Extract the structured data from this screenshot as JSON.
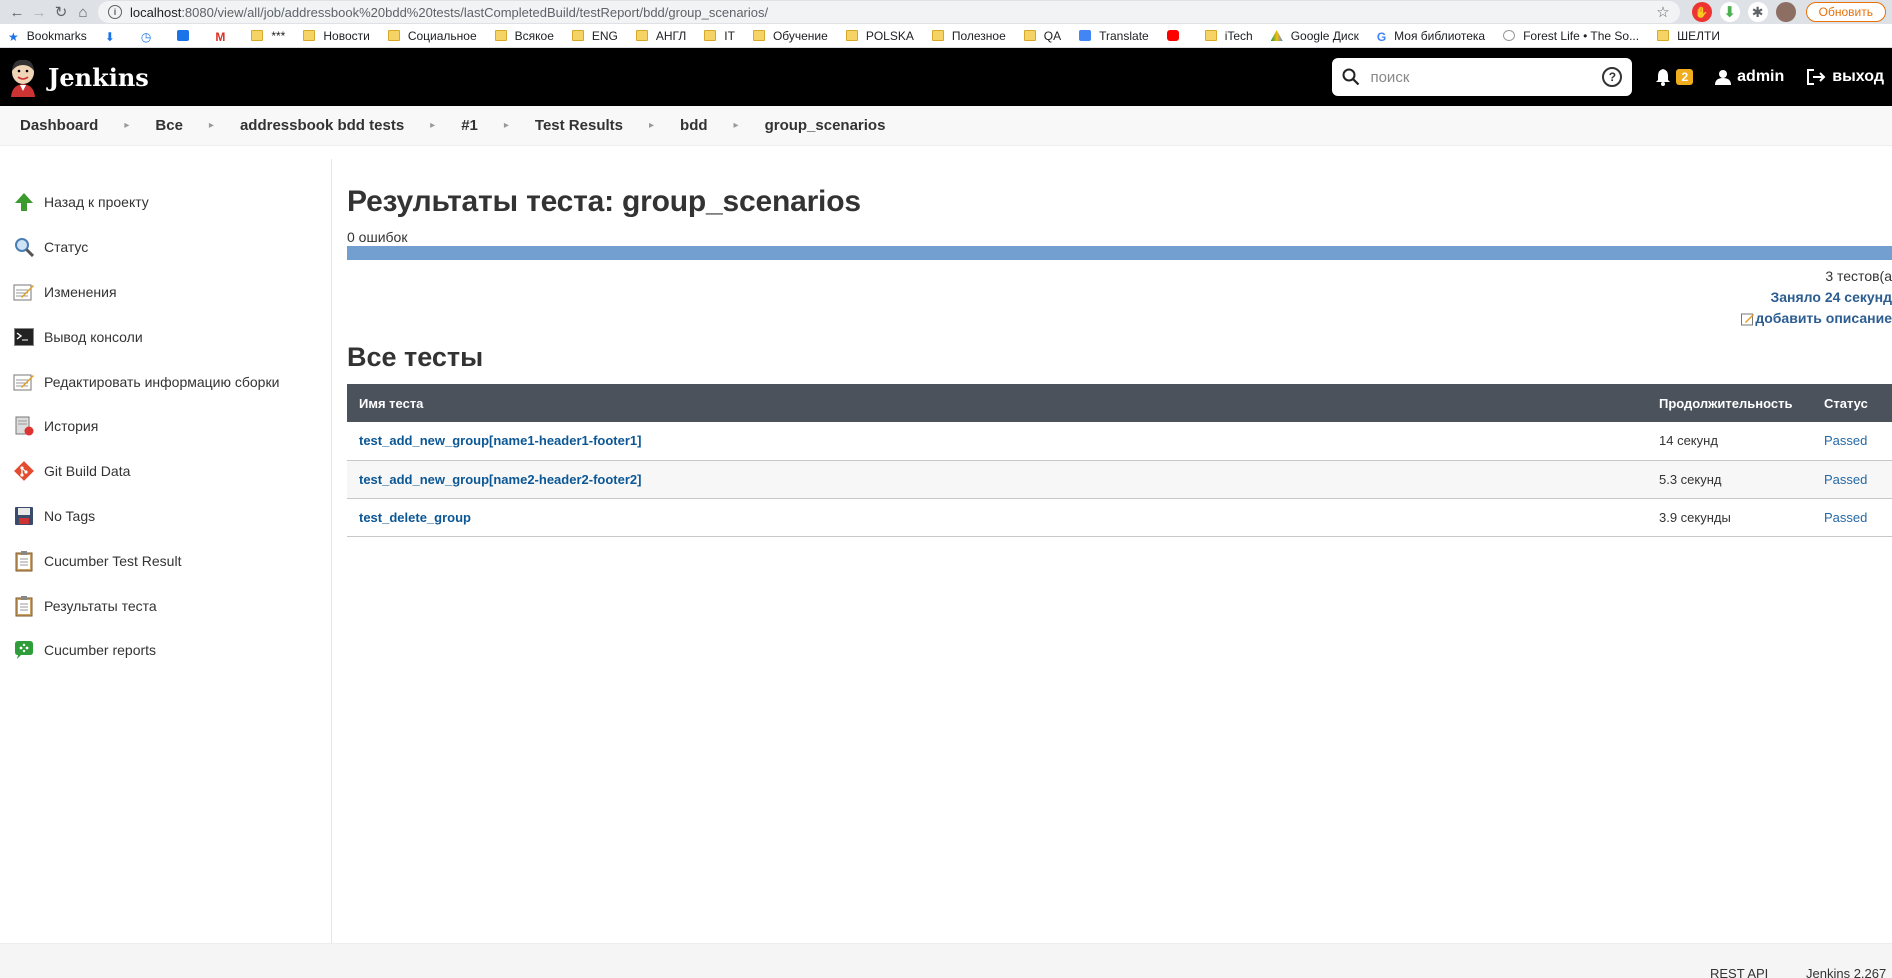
{
  "browser": {
    "address_host": "localhost",
    "address_path": ":8080/view/all/job/addressbook%20bdd%20tests/lastCompletedBuild/testReport/bdd/group_scenarios/",
    "update_label": "Обновить",
    "bookmarks": [
      "Bookmarks",
      "***",
      "Новости",
      "Социальное",
      "Всякое",
      "ENG",
      "АНГЛ",
      "IT",
      "Обучение",
      "POLSKA",
      "Полезное",
      "QA",
      "Translate",
      "iTech",
      "Google Диск",
      "Моя библиотека",
      "Forest Life • The So...",
      "ШЕЛТИ"
    ]
  },
  "header": {
    "logo_text": "Jenkins",
    "search_placeholder": "поиск",
    "notifications_count": "2",
    "user": "admin",
    "logout": "выход"
  },
  "breadcrumbs": [
    "Dashboard",
    "Все",
    "addressbook bdd tests",
    "#1",
    "Test Results",
    "bdd",
    "group_scenarios"
  ],
  "sidebar": {
    "items": [
      {
        "label": "Назад к проекту",
        "icon": "up-arrow-icon"
      },
      {
        "label": "Статус",
        "icon": "magnifier-icon"
      },
      {
        "label": "Изменения",
        "icon": "notepad-icon"
      },
      {
        "label": "Вывод консоли",
        "icon": "terminal-icon"
      },
      {
        "label": "Редактировать информацию сборки",
        "icon": "notepad-icon"
      },
      {
        "label": "История",
        "icon": "history-icon"
      },
      {
        "label": "Git Build Data",
        "icon": "git-icon"
      },
      {
        "label": "No Tags",
        "icon": "floppy-icon"
      },
      {
        "label": "Cucumber Test Result",
        "icon": "clipboard-icon"
      },
      {
        "label": "Результаты теста",
        "icon": "clipboard-icon"
      },
      {
        "label": "Cucumber reports",
        "icon": "cucumber-icon"
      }
    ]
  },
  "main": {
    "title": "Результаты теста: group_scenarios",
    "fail_count": "0 ошибок",
    "progress_fraction": 1.0,
    "tests_count": "3 тестов(а",
    "duration": "Заняло 24 секунд",
    "add_description": "добавить описание",
    "all_tests_heading": "Все тесты",
    "table": {
      "headers": [
        "Имя теста",
        "Продолжительность",
        "Статус"
      ],
      "rows": [
        {
          "name": "test_add_new_group[name1-header1-footer1]",
          "duration": "14 секунд",
          "status": "Passed"
        },
        {
          "name": "test_add_new_group[name2-header2-footer2]",
          "duration": "5.3 секунд",
          "status": "Passed"
        },
        {
          "name": "test_delete_group",
          "duration": "3.9 секунды",
          "status": "Passed"
        }
      ]
    }
  },
  "footer": {
    "rest_api": "REST API",
    "version": "Jenkins 2.267"
  }
}
